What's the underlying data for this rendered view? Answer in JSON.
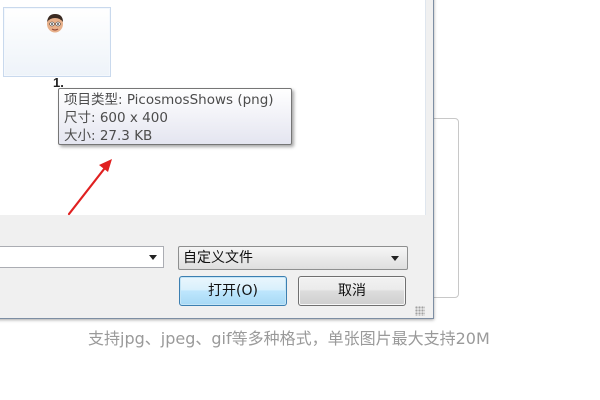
{
  "file_dialog": {
    "thumbnail_label": "1.",
    "filename_value": "",
    "file_type_selected": "自定义文件",
    "open_button": "打开(O)",
    "cancel_button": "取消"
  },
  "tooltip": {
    "type_line": "项目类型: PicosmosShows (png)",
    "size_line": "尺寸: 600 x 400",
    "filesize_line": "大小: 27.3 KB"
  },
  "hint_text": "支持jpg、jpeg、gif等多种格式，单张图片最大支持20M",
  "colors": {
    "annotation_arrow": "#e02020",
    "hint_text": "#9a9a9a",
    "open_button_border": "#3c7fb1"
  }
}
